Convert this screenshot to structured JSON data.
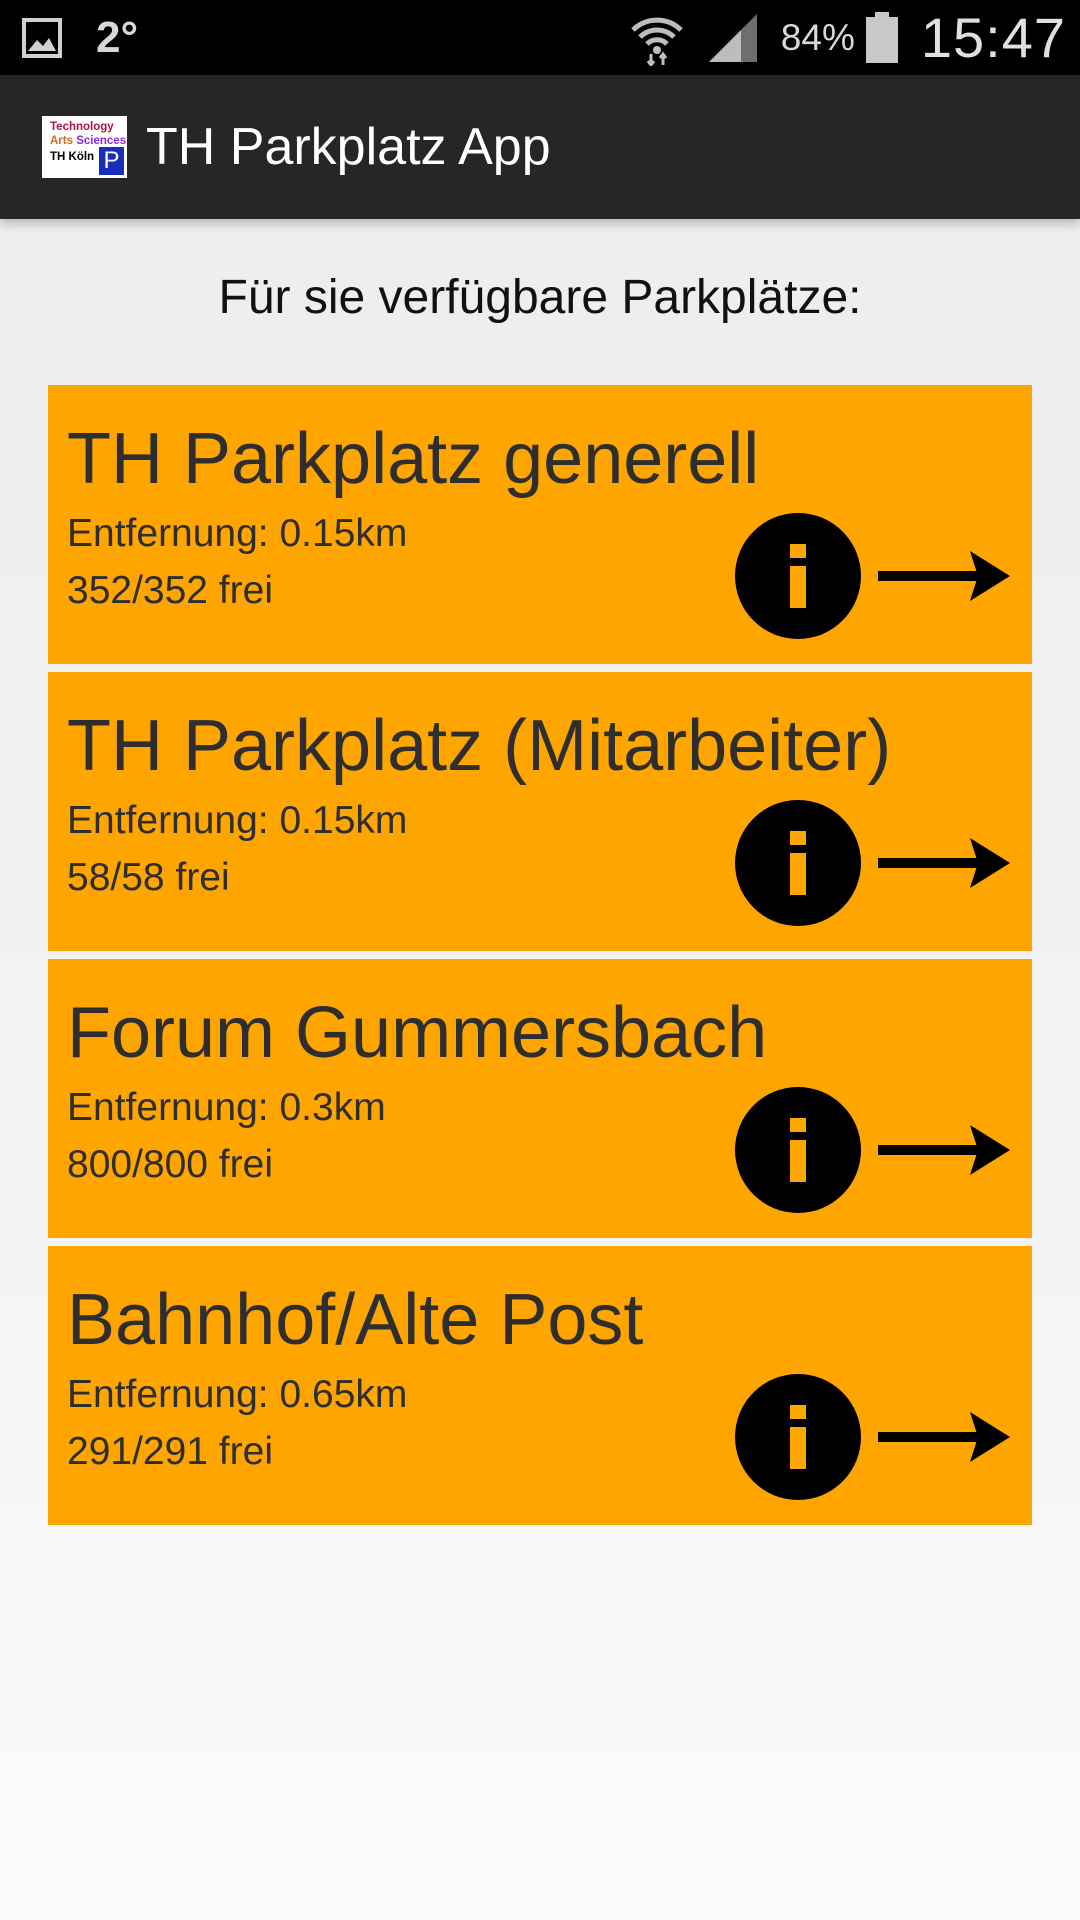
{
  "status_bar": {
    "temperature": "2°",
    "battery_percent": "84%",
    "time": "15:47",
    "icons": [
      "gallery-icon",
      "wifi-icon",
      "signal-icon",
      "battery-icon"
    ]
  },
  "action_bar": {
    "logo": {
      "line1": "Technology",
      "line2_a": "Arts",
      "line2_b": "Sciences",
      "line3": "TH Köln",
      "badge": "P"
    },
    "title": "TH Parkplatz App"
  },
  "heading": "Für sie verfügbare Parkplätze:",
  "colors": {
    "card_background": "#ffa500",
    "action_bar": "#262626",
    "status_bar": "#000000"
  },
  "parking_lots": [
    {
      "name": "TH Parkplatz generell",
      "distance": "Entfernung: 0.15km",
      "free": "352/352 frei"
    },
    {
      "name": "TH Parkplatz (Mitarbeiter)",
      "distance": "Entfernung: 0.15km",
      "free": "58/58 frei"
    },
    {
      "name": "Forum Gummersbach",
      "distance": "Entfernung: 0.3km",
      "free": "800/800 frei"
    },
    {
      "name": "Bahnhof/Alte Post",
      "distance": "Entfernung: 0.65km",
      "free": "291/291 frei"
    }
  ]
}
